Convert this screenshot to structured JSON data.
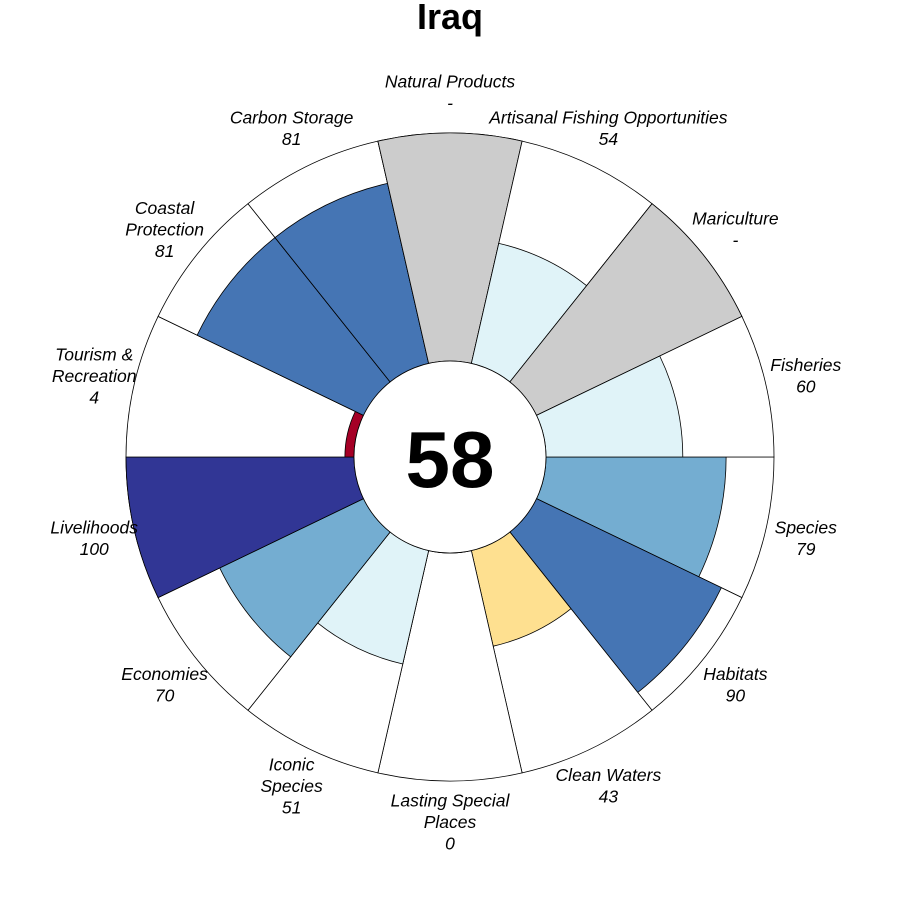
{
  "chart_data": {
    "type": "polar-bar",
    "title": "Iraq",
    "center_value": "58",
    "max_value": 100,
    "no_data_color": "#cccccc",
    "segments": [
      {
        "id": "species",
        "lines": [
          "Species"
        ],
        "value": 79,
        "display": "79",
        "color": "#74add1"
      },
      {
        "id": "habitats",
        "lines": [
          "Habitats"
        ],
        "value": 90,
        "display": "90",
        "color": "#4575b4"
      },
      {
        "id": "clean-waters",
        "lines": [
          "Clean Waters"
        ],
        "value": 43,
        "display": "43",
        "color": "#fee090"
      },
      {
        "id": "lasting-special-places",
        "lines": [
          "Lasting Special",
          "Places"
        ],
        "value": 0,
        "display": "0",
        "color": "#a50026"
      },
      {
        "id": "iconic-species",
        "lines": [
          "Iconic",
          "Species"
        ],
        "value": 51,
        "display": "51",
        "color": "#e0f3f8"
      },
      {
        "id": "economies",
        "lines": [
          "Economies"
        ],
        "value": 70,
        "display": "70",
        "color": "#74add1"
      },
      {
        "id": "livelihoods",
        "lines": [
          "Livelihoods"
        ],
        "value": 100,
        "display": "100",
        "color": "#313695"
      },
      {
        "id": "tourism-recreation",
        "lines": [
          "Tourism &",
          "Recreation"
        ],
        "value": 4,
        "display": "4",
        "color": "#a50026"
      },
      {
        "id": "coastal-protection",
        "lines": [
          "Coastal",
          "Protection"
        ],
        "value": 81,
        "display": "81",
        "color": "#4575b4"
      },
      {
        "id": "carbon-storage",
        "lines": [
          "Carbon Storage"
        ],
        "value": 81,
        "display": "81",
        "color": "#4575b4"
      },
      {
        "id": "natural-products",
        "lines": [
          "Natural Products"
        ],
        "value": null,
        "display": "-",
        "color": "#cccccc"
      },
      {
        "id": "artisanal-fishing-opportunities",
        "lines": [
          "Artisanal Fishing Opportunities"
        ],
        "value": 54,
        "display": "54",
        "color": "#e0f3f8"
      },
      {
        "id": "mariculture",
        "lines": [
          "Mariculture"
        ],
        "value": null,
        "display": "-",
        "color": "#cccccc"
      },
      {
        "id": "fisheries",
        "lines": [
          "Fisheries"
        ],
        "value": 60,
        "display": "60",
        "color": "#e0f3f8"
      }
    ]
  }
}
